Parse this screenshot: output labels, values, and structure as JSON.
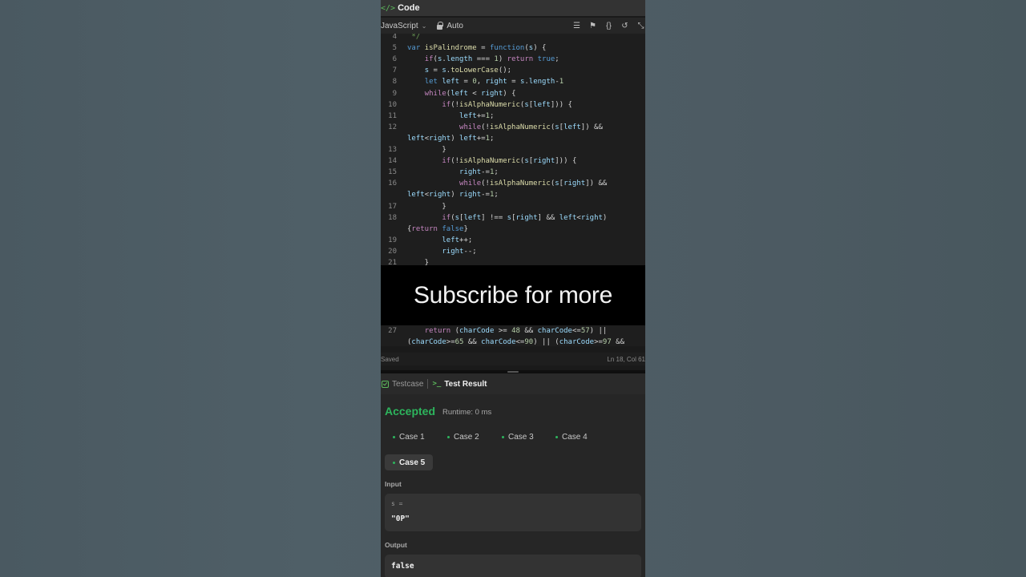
{
  "header": {
    "icon": "</>",
    "title": "Code"
  },
  "toolbar": {
    "language": "JavaScript",
    "mode": "Auto",
    "icons": [
      "format-icon",
      "bookmark-icon",
      "braces-icon",
      "undo-icon",
      "expand-icon"
    ]
  },
  "code": {
    "lines": [
      {
        "n": "4",
        "t": " */"
      },
      {
        "n": "5",
        "t": "var isPalindrome = function(s) {"
      },
      {
        "n": "6",
        "t": "    if(s.length === 1) return true;"
      },
      {
        "n": "7",
        "t": "    s = s.toLowerCase();"
      },
      {
        "n": "8",
        "t": "    let left = 0, right = s.length-1"
      },
      {
        "n": "9",
        "t": "    while(left < right) {"
      },
      {
        "n": "10",
        "t": "        if(!isAlphaNumeric(s[left])) {"
      },
      {
        "n": "11",
        "t": "            left+=1;"
      },
      {
        "n": "12",
        "t": "            while(!isAlphaNumeric(s[left]) &&"
      },
      {
        "n": "",
        "t": "left<right) left+=1;"
      },
      {
        "n": "13",
        "t": "        }"
      },
      {
        "n": "14",
        "t": "        if(!isAlphaNumeric(s[right])) {"
      },
      {
        "n": "15",
        "t": "            right-=1;"
      },
      {
        "n": "16",
        "t": "            while(!isAlphaNumeric(s[right]) &&"
      },
      {
        "n": "",
        "t": "left<right) right-=1;"
      },
      {
        "n": "17",
        "t": "        }"
      },
      {
        "n": "18",
        "t": "        if(s[left] !== s[right] && left<right)"
      },
      {
        "n": "",
        "t": "{return false}"
      },
      {
        "n": "19",
        "t": "        left++;"
      },
      {
        "n": "20",
        "t": "        right--;"
      },
      {
        "n": "21",
        "t": "    }"
      },
      {
        "n": "27",
        "t": "    return (charCode >= 48 && charCode<=57) ||"
      },
      {
        "n": "",
        "t": "(charCode>=65 && charCode<=90) || (charCode>=97 &&"
      }
    ]
  },
  "overlay": {
    "text": "Subscribe for more"
  },
  "status": {
    "saved": "Saved",
    "position": "Ln 18, Col 61"
  },
  "panel": {
    "tab_testcase": "Testcase",
    "tab_result": "Test Result",
    "verdict": "Accepted",
    "runtime": "Runtime: 0 ms",
    "cases": [
      "Case 1",
      "Case 2",
      "Case 3",
      "Case 4",
      "Case 5"
    ],
    "active_case": "Case 5",
    "input_label": "Input",
    "input_var": "s =",
    "input_value": "\"0P\"",
    "output_label": "Output",
    "output_value": "false"
  },
  "colors": {
    "accepted": "#2db55d",
    "background": "#4d5b63",
    "overlay": "#000000"
  }
}
